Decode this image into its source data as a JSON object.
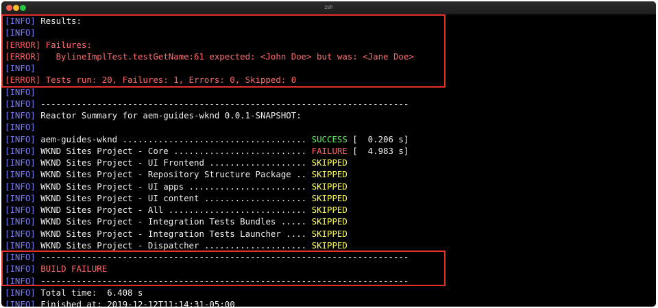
{
  "window": {
    "title": "zsh"
  },
  "colors": {
    "info": "#7a7cff",
    "error": "#ff5a5a",
    "text": "#f2f2f2",
    "success": "#5ff05f",
    "failure": "#ff6b6b",
    "skipped": "#ffff55",
    "highlight": "#e8302a"
  },
  "lines": [
    {
      "tag": "[INFO]",
      "level": "info",
      "parts": [
        {
          "text": " Results:",
          "color": "white"
        }
      ]
    },
    {
      "tag": "[INFO]",
      "level": "info",
      "parts": []
    },
    {
      "tag": "[ERROR]",
      "level": "error",
      "parts": [
        {
          "text": " Failures:",
          "color": "red"
        }
      ]
    },
    {
      "tag": "[ERROR]",
      "level": "error",
      "parts": [
        {
          "text": "   BylineImplTest.testGetName:61 expected: <John Doe> but was: <Jane Doe>",
          "color": "red"
        }
      ]
    },
    {
      "tag": "[INFO]",
      "level": "info",
      "parts": []
    },
    {
      "tag": "[ERROR]",
      "level": "error",
      "parts": [
        {
          "text": " Tests run: 20, Failures: 1, Errors: 0, Skipped: 0",
          "color": "red"
        }
      ]
    },
    {
      "tag": "[INFO]",
      "level": "info",
      "parts": []
    },
    {
      "tag": "[INFO]",
      "level": "info",
      "parts": [
        {
          "text": " ------------------------------------------------------------------------",
          "color": "white"
        }
      ]
    },
    {
      "tag": "[INFO]",
      "level": "info",
      "parts": [
        {
          "text": " Reactor Summary for aem-guides-wknd 0.0.1-SNAPSHOT:",
          "color": "white"
        }
      ]
    },
    {
      "tag": "[INFO]",
      "level": "info",
      "parts": []
    },
    {
      "tag": "[INFO]",
      "level": "info",
      "parts": [
        {
          "text": " aem-guides-wknd .................................... ",
          "color": "white"
        },
        {
          "text": "SUCCESS",
          "color": "green"
        },
        {
          "text": " [  0.206 s]",
          "color": "white"
        }
      ]
    },
    {
      "tag": "[INFO]",
      "level": "info",
      "parts": [
        {
          "text": " WKND Sites Project - Core .......................... ",
          "color": "white"
        },
        {
          "text": "FAILURE",
          "color": "red"
        },
        {
          "text": " [  4.983 s]",
          "color": "white"
        }
      ]
    },
    {
      "tag": "[INFO]",
      "level": "info",
      "parts": [
        {
          "text": " WKND Sites Project - UI Frontend ................... ",
          "color": "white"
        },
        {
          "text": "SKIPPED",
          "color": "yellow"
        }
      ]
    },
    {
      "tag": "[INFO]",
      "level": "info",
      "parts": [
        {
          "text": " WKND Sites Project - Repository Structure Package .. ",
          "color": "white"
        },
        {
          "text": "SKIPPED",
          "color": "yellow"
        }
      ]
    },
    {
      "tag": "[INFO]",
      "level": "info",
      "parts": [
        {
          "text": " WKND Sites Project - UI apps ....................... ",
          "color": "white"
        },
        {
          "text": "SKIPPED",
          "color": "yellow"
        }
      ]
    },
    {
      "tag": "[INFO]",
      "level": "info",
      "parts": [
        {
          "text": " WKND Sites Project - UI content .................... ",
          "color": "white"
        },
        {
          "text": "SKIPPED",
          "color": "yellow"
        }
      ]
    },
    {
      "tag": "[INFO]",
      "level": "info",
      "parts": [
        {
          "text": " WKND Sites Project - All ........................... ",
          "color": "white"
        },
        {
          "text": "SKIPPED",
          "color": "yellow"
        }
      ]
    },
    {
      "tag": "[INFO]",
      "level": "info",
      "parts": [
        {
          "text": " WKND Sites Project - Integration Tests Bundles ..... ",
          "color": "white"
        },
        {
          "text": "SKIPPED",
          "color": "yellow"
        }
      ]
    },
    {
      "tag": "[INFO]",
      "level": "info",
      "parts": [
        {
          "text": " WKND Sites Project - Integration Tests Launcher .... ",
          "color": "white"
        },
        {
          "text": "SKIPPED",
          "color": "yellow"
        }
      ]
    },
    {
      "tag": "[INFO]",
      "level": "info",
      "parts": [
        {
          "text": " WKND Sites Project - Dispatcher .................... ",
          "color": "white"
        },
        {
          "text": "SKIPPED",
          "color": "yellow"
        }
      ]
    },
    {
      "tag": "[INFO]",
      "level": "info",
      "parts": [
        {
          "text": " ------------------------------------------------------------------------",
          "color": "white"
        }
      ]
    },
    {
      "tag": "[INFO]",
      "level": "info",
      "parts": [
        {
          "text": " BUILD FAILURE",
          "color": "red"
        }
      ]
    },
    {
      "tag": "[INFO]",
      "level": "info",
      "parts": [
        {
          "text": " ------------------------------------------------------------------------",
          "color": "white"
        }
      ]
    },
    {
      "tag": "[INFO]",
      "level": "info",
      "parts": [
        {
          "text": " Total time:  6.408 s",
          "color": "white"
        }
      ]
    },
    {
      "tag": "[INFO]",
      "level": "info",
      "parts": [
        {
          "text": " Finished at: 2019-12-12T11:14:31-05:00",
          "color": "white"
        }
      ]
    }
  ]
}
